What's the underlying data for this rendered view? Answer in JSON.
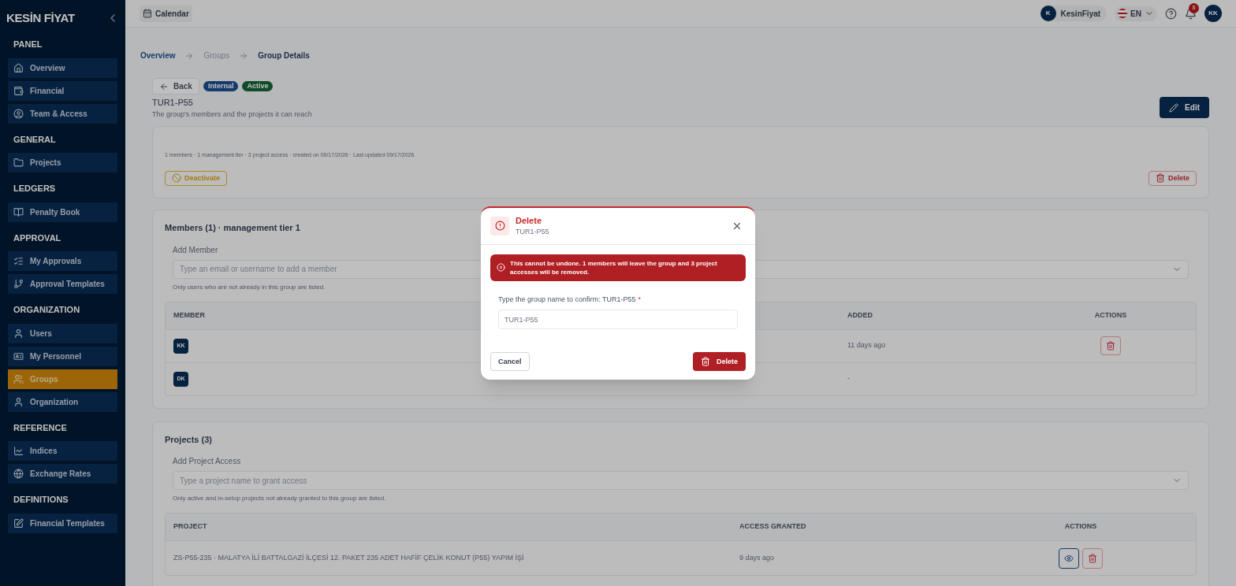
{
  "sidebar": {
    "logo": "KESİN FİYAT",
    "sections": [
      {
        "title": "PANEL",
        "items": [
          {
            "label": "Overview",
            "selected": false
          },
          {
            "label": "Financial",
            "selected": false
          },
          {
            "label": "Team & Access",
            "selected": false
          }
        ]
      },
      {
        "title": "GENERAL",
        "items": [
          {
            "label": "Projects",
            "selected": false
          }
        ]
      },
      {
        "title": "LEDGERS",
        "items": [
          {
            "label": "Penalty Book",
            "selected": false
          }
        ]
      },
      {
        "title": "APPROVAL",
        "items": [
          {
            "label": "My Approvals",
            "selected": false
          },
          {
            "label": "Approval Templates",
            "selected": false
          }
        ]
      },
      {
        "title": "ORGANIZATION",
        "items": [
          {
            "label": "Users",
            "selected": false
          },
          {
            "label": "My Personnel",
            "selected": false
          },
          {
            "label": "Groups",
            "selected": true
          },
          {
            "label": "Organization",
            "selected": false
          }
        ]
      },
      {
        "title": "REFERENCE",
        "items": [
          {
            "label": "Indices",
            "selected": false
          },
          {
            "label": "Exchange Rates",
            "selected": false
          }
        ]
      },
      {
        "title": "DEFINITIONS",
        "items": [
          {
            "label": "Financial Templates",
            "selected": false
          }
        ]
      }
    ]
  },
  "topbar": {
    "calendar": "Calendar",
    "user_initial": "K",
    "user_name": "KesinFiyat",
    "language": "EN",
    "notifications": "8",
    "avatar": "KK"
  },
  "breadcrumbs": [
    {
      "label": "Overview",
      "kind": "link"
    },
    {
      "label": "Groups",
      "kind": "plain"
    },
    {
      "label": "Group Details",
      "kind": "current"
    }
  ],
  "header": {
    "back": "Back",
    "badges": [
      {
        "label": "Internal",
        "kind": "type"
      },
      {
        "label": "Active",
        "kind": "status"
      }
    ],
    "title": "TUR1-P55",
    "subtitle": "The group's members and the projects it can reach",
    "edit": "Edit"
  },
  "summary": {
    "meta": "1 members · 1 management tier · 3 project access · created on 09/17/2026 · Last updated 09/17/2026",
    "deactivate": "Deactivate",
    "delete": "Delete"
  },
  "members": {
    "title": "Members (1) · management tier 1",
    "add_label": "Add Member",
    "placeholder": "Type an email or username to add a member",
    "hint": "Only users who are not already in this group are listed.",
    "columns": [
      "MEMBER",
      "ADDED",
      "ACTIONS"
    ],
    "rows": [
      {
        "avatar": "KK",
        "added": "11 days ago",
        "removable": true
      },
      {
        "avatar": "DK",
        "added": "-",
        "removable": false
      }
    ]
  },
  "projects": {
    "title": "Projects (3)",
    "add_label": "Add Project Access",
    "placeholder": "Type a project name to grant access",
    "hint": "Only active and in-setup projects not already granted to this group are listed.",
    "columns": [
      "PROJECT",
      "ACCESS GRANTED",
      "ACTIONS"
    ],
    "rows": [
      {
        "project": "ZS-P55-235 · MALATYA İLİ BATTALGAZİ İLÇESİ 12. PAKET 235 ADET HAFİF ÇELİK KONUT (P55) YAPIM İŞİ",
        "granted": "9 days ago"
      }
    ]
  },
  "dialog": {
    "title": "Delete",
    "subtitle": "TUR1-P55",
    "warning": "This cannot be undone. 1 members will leave the group and 3 project accesses will be removed.",
    "field_label": "Type the group name to confirm: TUR1-P55",
    "required_mark": "*",
    "placeholder": "TUR1-P55",
    "cancel": "Cancel",
    "confirm": "Delete"
  }
}
